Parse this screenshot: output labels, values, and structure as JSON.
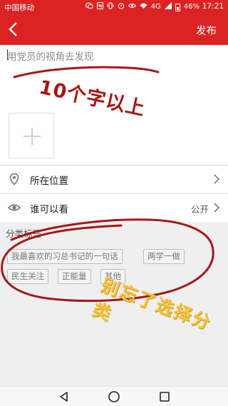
{
  "status_bar": {
    "carrier": "中国移动",
    "icons": [
      "wechat-icon",
      "nfc-icon",
      "vibrate-icon",
      "alarm-icon",
      "eye-icon",
      "wifi-icon",
      "signal-icon",
      "battery-icon"
    ],
    "network": "4G",
    "battery": "46%",
    "time": "17:21"
  },
  "header": {
    "back_icon": "chevron-left-icon",
    "publish_label": "发布"
  },
  "composer": {
    "placeholder": "用党员的视角去发现",
    "add_image_icon": "plus-icon"
  },
  "rows": {
    "location": {
      "icon": "location-pin-icon",
      "label": "所在位置"
    },
    "visibility": {
      "icon": "eye-icon",
      "label": "谁可以看",
      "value": "公开"
    }
  },
  "tags_section": {
    "title": "分类标签",
    "tags": [
      "我最喜欢的习总书记的一句话",
      "两学一做",
      "民生关注",
      "正能量",
      "其他"
    ]
  },
  "annotations": {
    "note_1": "10个字以上",
    "note_2": "别忘了选择分类",
    "ink_color": "#a51818",
    "yellow_color": "#f7c23a"
  },
  "theme": {
    "accent": "#dc2323",
    "background": "#ffffff",
    "section_bg": "#efefef"
  },
  "nav_bar": {
    "icons": [
      "back-triangle-icon",
      "home-circle-icon",
      "recents-square-icon"
    ]
  }
}
